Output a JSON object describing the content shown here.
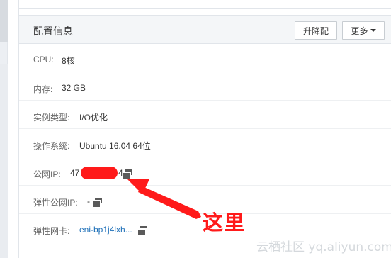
{
  "section": {
    "title": "配置信息",
    "upgrade_label": "升降配",
    "more_label": "更多"
  },
  "rows": [
    {
      "label": "CPU:",
      "value": "8核"
    },
    {
      "label": "内存:",
      "value": "32 GB"
    },
    {
      "label": "实例类型:",
      "value": "I/O优化"
    },
    {
      "label": "操作系统:",
      "value": "Ubuntu 16.04 64位"
    },
    {
      "label": "公网IP:",
      "value_prefix": "47",
      "value_suffix": "4"
    },
    {
      "label": "弹性公网IP:",
      "value": "-"
    },
    {
      "label": "弹性网卡:",
      "value": "eni-bp1j4lxh..."
    }
  ],
  "annotation": {
    "text": "这里",
    "color": "#ff1a1a"
  },
  "watermark": "云栖社区 yq.aliyun.com",
  "colors": {
    "link": "#1d6fb8",
    "header_bg": "#f4f6f8",
    "redaction": "#ff1a1a"
  }
}
